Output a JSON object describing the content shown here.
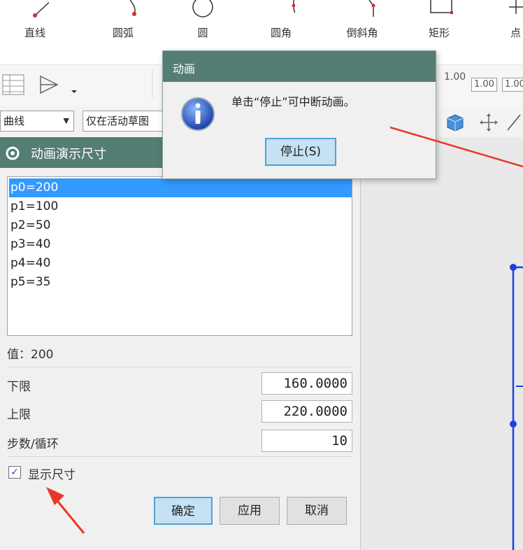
{
  "ribbon": {
    "tools": [
      {
        "label": "直线",
        "icon": "line-icon"
      },
      {
        "label": "圆弧",
        "icon": "arc-icon"
      },
      {
        "label": "圆",
        "icon": "circle-icon"
      },
      {
        "label": "圆角",
        "icon": "fillet-icon"
      },
      {
        "label": "倒斜角",
        "icon": "chamfer-icon"
      },
      {
        "label": "矩形",
        "icon": "rectangle-icon"
      },
      {
        "label": "点",
        "icon": "point-icon"
      }
    ]
  },
  "toolbar": {
    "badge1": "1.00",
    "badge2": "1.00",
    "badge3": "1.00"
  },
  "filter": {
    "type_filter": "曲线",
    "scope_filter": "仅在活动草图"
  },
  "animate_dialog": {
    "title": "动画演示尺寸",
    "parameters": [
      "p0=200",
      "p1=100",
      "p2=50",
      "p3=40",
      "p4=40",
      "p5=35"
    ],
    "selected_index": 0,
    "value_label": "值：200",
    "lower_label": "下限",
    "lower_value": "160.0000",
    "upper_label": "上限",
    "upper_value": "220.0000",
    "steps_label": "步数/循环",
    "steps_value": "10",
    "show_dims_label": "显示尺寸",
    "show_dims_checked": true,
    "ok_label": "确定",
    "apply_label": "应用",
    "cancel_label": "取消"
  },
  "message_dialog": {
    "title": "动画",
    "text": "单击“停止”可中断动画。",
    "stop_label": "停止(S)"
  },
  "colors": {
    "header": "#547d74",
    "selection": "#3399ff",
    "primary_button": "#c5e1f3",
    "sketch_line": "#1f3fe0",
    "annotation_arrow": "#e8382a"
  }
}
